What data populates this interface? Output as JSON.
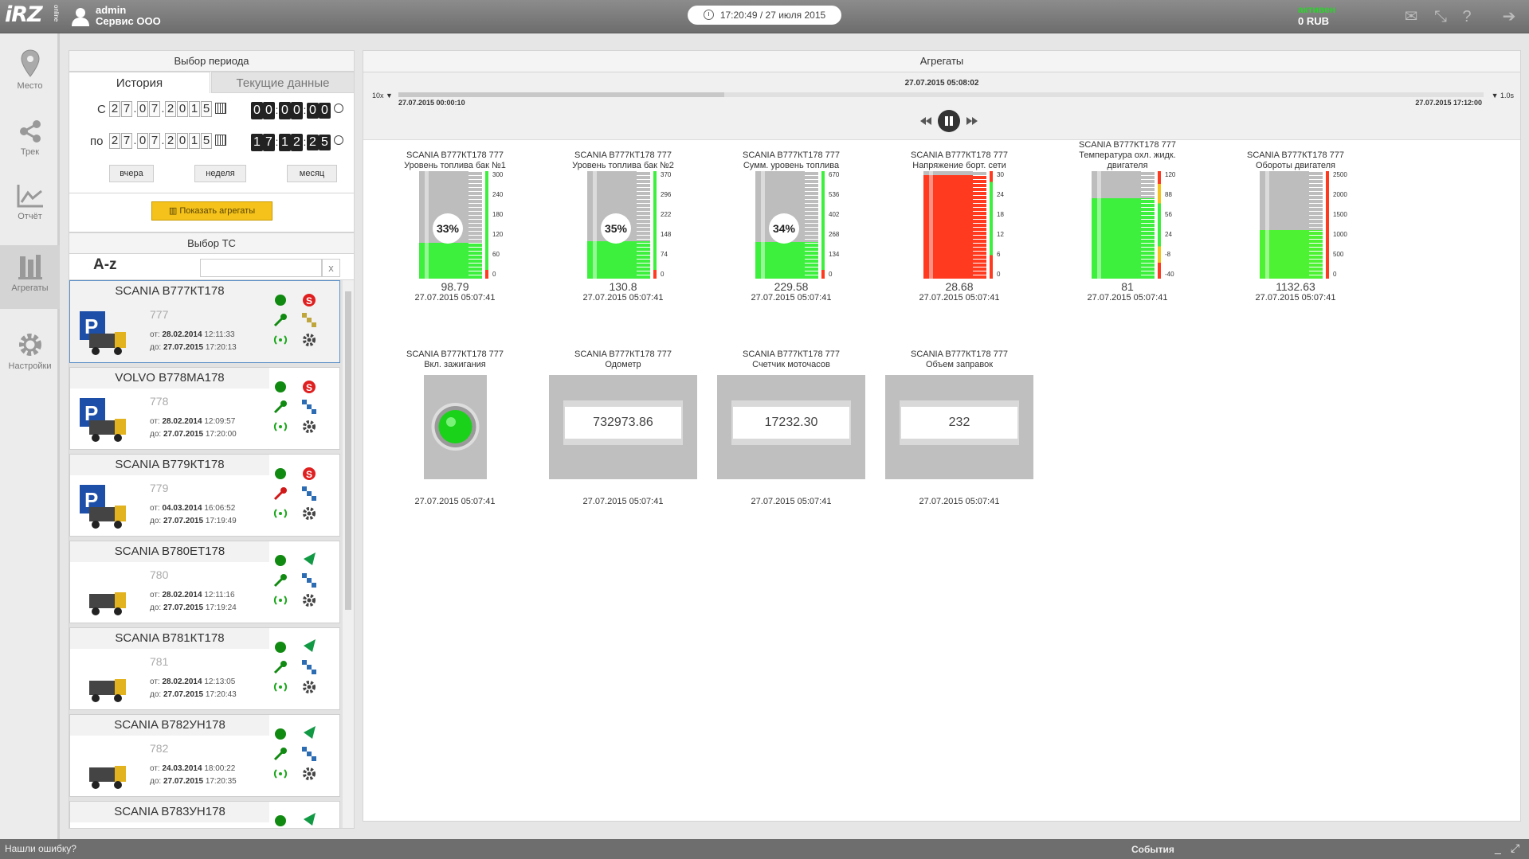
{
  "header": {
    "logo_main": "iRZ",
    "logo_sub": "online",
    "username": "admin",
    "company": "Сервис ООО",
    "clock": "17:20:49 / 27 июля 2015",
    "status": "активен",
    "balance": "0 RUB"
  },
  "sidenav": [
    {
      "label": "Место",
      "icon": "map-pin-icon"
    },
    {
      "label": "Трек",
      "icon": "share-icon"
    },
    {
      "label": "Отчёт",
      "icon": "chart-icon"
    },
    {
      "label": "Агрегаты",
      "icon": "bars-icon"
    },
    {
      "label": "Настройки",
      "icon": "gear-icon"
    }
  ],
  "left": {
    "period_title": "Выбор периода",
    "tab_history": "История",
    "tab_current": "Текущие данные",
    "from_label": "С",
    "to_label": "по",
    "from_date": [
      "2",
      "7",
      "0",
      "7",
      "2",
      "0",
      "1",
      "5"
    ],
    "from_time": [
      "0",
      "0",
      "0",
      "0",
      "0",
      "0"
    ],
    "to_date": [
      "2",
      "7",
      "0",
      "7",
      "2",
      "0",
      "1",
      "5"
    ],
    "to_time": [
      "1",
      "7",
      "1",
      "2",
      "2",
      "5"
    ],
    "btn_yesterday": "вчера",
    "btn_week": "неделя",
    "btn_month": "месяц",
    "show_button": "Показать агрегаты",
    "vehicle_title": "Выбор ТС",
    "sort_label": "A-z",
    "search_placeholder": "",
    "clear": "x"
  },
  "vehicles": [
    {
      "name": "SCANIA В777КТ178",
      "num": "777",
      "from": "28.02.2014",
      "from_t": "12:11:33",
      "to": "27.07.2015",
      "to_t": "17:20:13"
    },
    {
      "name": "VOLVO В778МА178",
      "num": "778",
      "from": "28.02.2014",
      "from_t": "12:09:57",
      "to": "27.07.2015",
      "to_t": "17:20:00"
    },
    {
      "name": "SCANIA В779КТ178",
      "num": "779",
      "from": "04.03.2014",
      "from_t": "16:06:52",
      "to": "27.07.2015",
      "to_t": "17:19:49"
    },
    {
      "name": "SCANIA В780ЕТ178",
      "num": "780",
      "from": "28.02.2014",
      "from_t": "12:11:16",
      "to": "27.07.2015",
      "to_t": "17:19:24"
    },
    {
      "name": "SCANIA В781КТ178",
      "num": "781",
      "from": "28.02.2014",
      "from_t": "12:13:05",
      "to": "27.07.2015",
      "to_t": "17:20:43"
    },
    {
      "name": "SCANIA В782УН178",
      "num": "782",
      "from": "24.03.2014",
      "from_t": "18:00:22",
      "to": "27.07.2015",
      "to_t": "17:20:35"
    },
    {
      "name": "SCANIA В783УН178",
      "num": "",
      "from": "",
      "from_t": "",
      "to": "",
      "to_t": ""
    }
  ],
  "vlabels": {
    "from": "от:",
    "to": "до:"
  },
  "main": {
    "title": "Агрегаты",
    "current_time": "27.07.2015 05:08:02",
    "speed_left": "10x",
    "speed_right": "1.0s",
    "start": "27.07.2015 00:00:10",
    "end": "27.07.2015 17:12:00",
    "playback_progress": 0.3
  },
  "gauges": [
    {
      "t1": "SCANIA В777КТ178 777",
      "t2": "Уровень топлива бак №1",
      "pct": "33%",
      "level": 0.33,
      "color": "#3ef03e",
      "val": "98.79",
      "time": "27.07.2015 05:07:41",
      "scale": [
        "300",
        "240",
        "180",
        "120",
        "60",
        "0"
      ]
    },
    {
      "t1": "SCANIA В777КТ178 777",
      "t2": "Уровень топлива бак №2",
      "pct": "35%",
      "level": 0.35,
      "color": "#3ef03e",
      "val": "130.8",
      "time": "27.07.2015 05:07:41",
      "scale": [
        "370",
        "296",
        "222",
        "148",
        "74",
        "0"
      ]
    },
    {
      "t1": "SCANIA В777КТ178 777",
      "t2": "Сумм. уровень топлива",
      "pct": "34%",
      "level": 0.34,
      "color": "#3ef03e",
      "val": "229.58",
      "time": "27.07.2015 05:07:41",
      "scale": [
        "670",
        "536",
        "402",
        "268",
        "134",
        "0"
      ]
    },
    {
      "t1": "SCANIA В777КТ178 777",
      "t2": "Напряжение борт. сети",
      "pct": "",
      "level": 0.96,
      "color": "#ff3a1f",
      "val": "28.68",
      "time": "27.07.2015 05:07:41",
      "scale": [
        "30",
        "24",
        "18",
        "12",
        "6",
        "0"
      ]
    },
    {
      "t1": "SCANIA В777КТ178 777",
      "t2": "Температура охл. жидк.",
      "t3": "двигателя",
      "pct": "",
      "level": 0.75,
      "color": "#3ef03e",
      "val": "81",
      "time": "27.07.2015 05:07:41",
      "scale": [
        "120",
        "88",
        "56",
        "24",
        "-8",
        "-40"
      ]
    },
    {
      "t1": "SCANIA В777КТ178 777",
      "t2": "Обороты двигателя",
      "pct": "",
      "level": 0.45,
      "color": "#4df233",
      "val": "1132.63",
      "time": "27.07.2015 05:07:41",
      "scale": [
        "2500",
        "2000",
        "1500",
        "1000",
        "500",
        "0"
      ]
    }
  ],
  "row2": [
    {
      "t1": "SCANIA В777КТ178 777",
      "t2": "Вкл. зажигания",
      "val": "",
      "time": "27.07.2015 05:07:41"
    },
    {
      "t1": "SCANIA В777КТ178 777",
      "t2": "Одометр",
      "val": "732973.86",
      "time": "27.07.2015 05:07:41"
    },
    {
      "t1": "SCANIA В777КТ178 777",
      "t2": "Счетчик моточасов",
      "val": "17232.30",
      "time": "27.07.2015 05:07:41"
    },
    {
      "t1": "SCANIA В777КТ178 777",
      "t2": "Объем заправок",
      "val": "232",
      "time": "27.07.2015 05:07:41"
    }
  ],
  "footer": {
    "bug": "Нашли ошибку?",
    "events": "События"
  },
  "colors": {
    "green": "#3ef03e",
    "red": "#ff3a1f",
    "yellow": "#f4c21b",
    "dark_green": "#118a11"
  }
}
